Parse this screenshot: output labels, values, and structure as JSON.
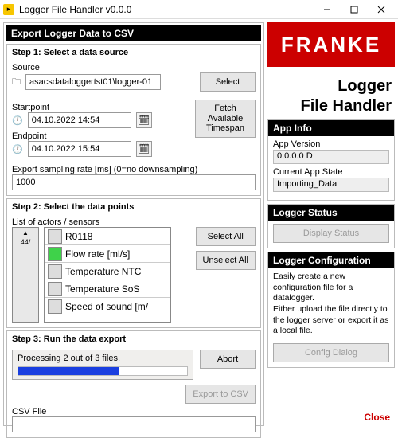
{
  "window": {
    "title": "Logger File Handler v0.0.0"
  },
  "export": {
    "title": "Export Logger Data to CSV",
    "step1": {
      "legend": "Step 1:  Select a data source",
      "source_label": "Source",
      "source_value": "asacsdataloggertst01\\logger-01",
      "select_btn": "Select",
      "startpoint_label": "Startpoint",
      "startpoint_value": "04.10.2022 14:54",
      "endpoint_label": "Endpoint",
      "endpoint_value": "04.10.2022 15:54",
      "fetch_btn": "Fetch\nAvailable\nTimespan",
      "sampling_label": "Export sampling rate [ms] (0=no downsampling)",
      "sampling_value": "1000"
    },
    "step2": {
      "legend": "Step 2:  Select the data points",
      "list_label": "List of actors / sensors",
      "knob_value": "44/",
      "items": [
        {
          "label": "R0118",
          "on": false
        },
        {
          "label": "Flow rate [ml/s]",
          "on": true
        },
        {
          "label": "Temperature NTC",
          "on": false
        },
        {
          "label": "Temperature SoS",
          "on": false
        },
        {
          "label": "Speed of sound [m/",
          "on": false
        }
      ],
      "select_all_btn": "Select All",
      "unselect_all_btn": "Unselect All"
    },
    "step3": {
      "legend": "Step 3:  Run the data export",
      "progress_text": "Processing 2 out of 3 files.",
      "progress_pct": 60,
      "abort_btn": "Abort",
      "export_btn": "Export to CSV",
      "csvfile_label": "CSV File",
      "csvfile_value": ""
    }
  },
  "brand": {
    "logo": "FRANKE",
    "line1": "Logger",
    "line2": "File Handler"
  },
  "appinfo": {
    "title": "App Info",
    "version_label": "App Version",
    "version_value": "0.0.0.0 D",
    "state_label": "Current App State",
    "state_value": "Importing_Data"
  },
  "status": {
    "title": "Logger Status",
    "display_btn": "Display Status"
  },
  "config": {
    "title": "Logger Configuration",
    "desc": "Easily create a new configuration file for a datalogger.\nEither upload the file directly to the logger server or export it as a local file.",
    "dialog_btn": "Config Dialog"
  },
  "close_btn": "Close"
}
